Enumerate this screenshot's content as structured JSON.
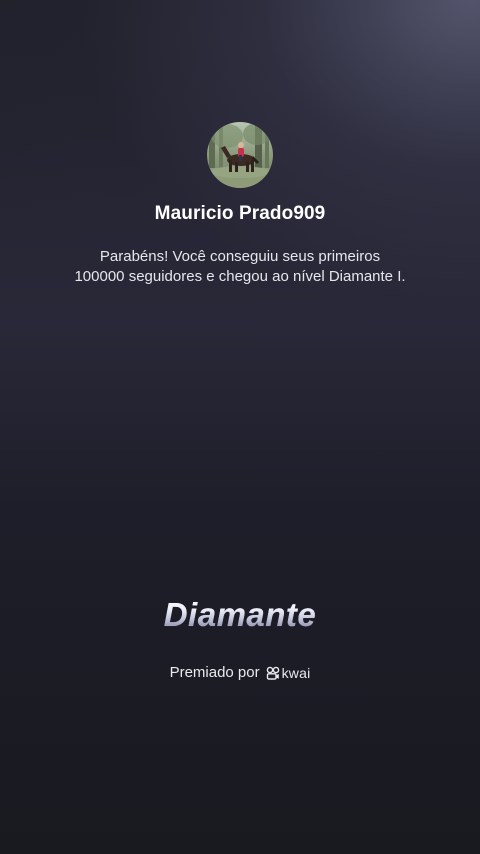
{
  "profile": {
    "username": "Mauricio Prado909",
    "avatar_icon": "avatar-photo"
  },
  "message": {
    "line1": "Parabéns! Você conseguiu seus primeiros",
    "line2": "100000 seguidores e chegou ao nível Diamante I."
  },
  "badge": {
    "title": "Diamante",
    "level_color": "#c8cbe0"
  },
  "award": {
    "label": "Premiado por",
    "brand": "kwai",
    "brand_icon": "kwai-logo-icon"
  },
  "colors": {
    "background_top": "#22222f",
    "background_bottom": "#191920",
    "text": "#ffffff"
  }
}
